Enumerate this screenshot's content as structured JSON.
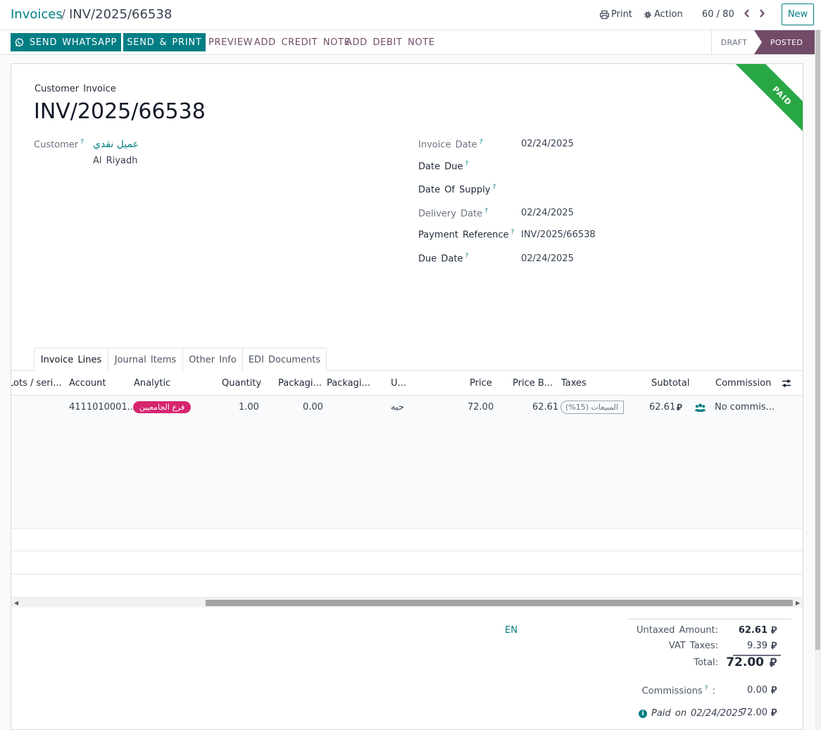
{
  "breadcrumb": {
    "root": "Invoices",
    "separator": "/",
    "current": "INV/2025/66538"
  },
  "toolbar": {
    "print_label": "Print",
    "action_label": "Action",
    "pager": "60 / 80",
    "new_label": "New"
  },
  "statusbar": {
    "send_whatsapp": "SEND WHATSAPP",
    "send_print": "SEND & PRINT",
    "preview": "PREVIEW",
    "add_credit_note": "ADD CREDIT NOTE",
    "add_debit_note": "ADD DEBIT NOTE",
    "stages": {
      "draft": "DRAFT",
      "posted": "POSTED"
    }
  },
  "ribbon": "PAID",
  "invoice": {
    "type_label": "Customer Invoice",
    "number": "INV/2025/66538",
    "customer_label": "Customer",
    "customer_name": "عميل نقدي",
    "customer_city": "Al Riyadh",
    "fields": {
      "invoice_date_label": "Invoice Date",
      "invoice_date": "02/24/2025",
      "date_due_label": "Date Due",
      "date_of_supply_label": "Date Of Supply",
      "delivery_date_label": "Delivery Date",
      "delivery_date": "02/24/2025",
      "payment_reference_label": "Payment Reference",
      "payment_reference": "INV/2025/66538",
      "due_date_label": "Due Date",
      "due_date": "02/24/2025"
    }
  },
  "tabs": [
    "Invoice Lines",
    "Journal Items",
    "Other Info",
    "EDI Documents"
  ],
  "table": {
    "headers": {
      "lots": "Lots / seri...",
      "account": "Account",
      "analytic": "Analytic",
      "quantity": "Quantity",
      "packaging1": "Packagi...",
      "packaging2": "Packagi...",
      "uom": "U...",
      "price": "Price",
      "price_before": "Price B...",
      "taxes": "Taxes",
      "subtotal": "Subtotal",
      "commission": "Commission"
    },
    "row": {
      "account": "4111010001...",
      "analytic": "فرع الجامعيين",
      "quantity": "1.00",
      "packaging_qty": "0.00",
      "uom": "حبه",
      "price": "72.00",
      "price_before": "62.61",
      "taxes": "المبيعات (15%)",
      "subtotal": "62.61",
      "commission": "No commis..."
    }
  },
  "totals": {
    "lang": "EN",
    "untaxed_label": "Untaxed Amount:",
    "untaxed": "62.61",
    "vat_label": "VAT Taxes:",
    "vat": "9.39",
    "total_label": "Total:",
    "total": "72.00",
    "commissions_label": "Commissions",
    "commissions": "0.00",
    "paid_on_label": "Paid on",
    "paid_on_date": "02/24/2025",
    "paid_amount": "72.00",
    "currency_symbol": "⃁"
  },
  "colors": {
    "primary": "#017e84",
    "brand": "#714b67",
    "paid": "#28a745",
    "badge": "#d6246e"
  }
}
